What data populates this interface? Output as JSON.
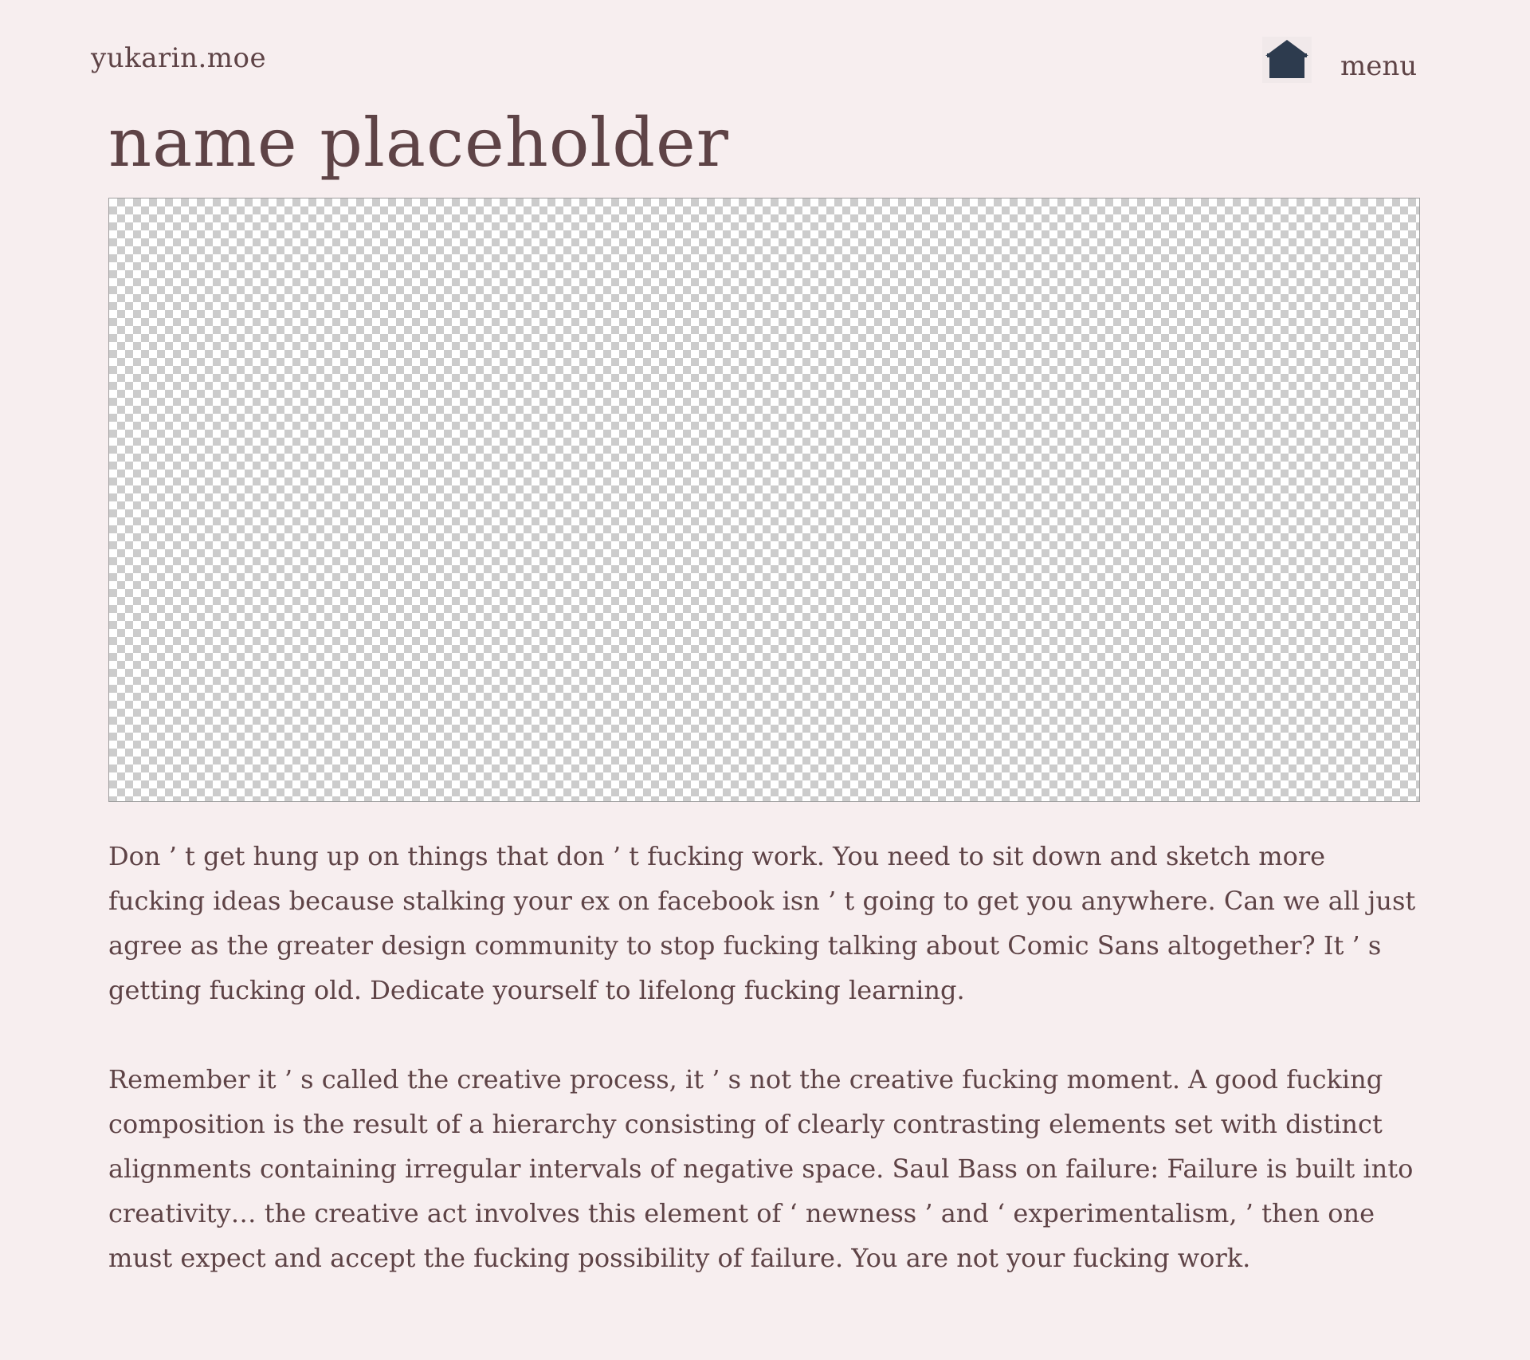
{
  "header": {
    "site_name": "yukarin.moe",
    "home_icon": "home-icon",
    "menu_label": "menu"
  },
  "main": {
    "title": "name placeholder",
    "image": {
      "kind": "transparent-checkerboard-placeholder"
    },
    "paragraphs": [
      "Don ’ t get hung up on things that don ’ t fucking work. You need to sit down and sketch more fucking ideas because stalking your ex on facebook isn ’ t going to get you anywhere. Can we all just agree as the greater design community to stop fucking talking about Comic Sans altogether? It ’ s getting fucking old. Dedicate yourself to lifelong fucking learning.",
      "Remember it ’ s called the creative process, it ’ s not the creative fucking moment. A good fucking composition is the result of a hierarchy consisting of clearly contrasting elements set with distinct alignments containing irregular intervals of negative space. Saul Bass on failure: Failure is built into creativity… the creative act involves this element of ‘ newness ’ and ‘ experimentalism, ’ then one must expect and accept the fucking possibility of failure. You are not your fucking work."
    ]
  },
  "colors": {
    "background": "#f7eeef",
    "text": "#5e4346",
    "home_icon": "#2d3b4e",
    "checker_dark": "#cccccc",
    "checker_light": "#ffffff"
  }
}
